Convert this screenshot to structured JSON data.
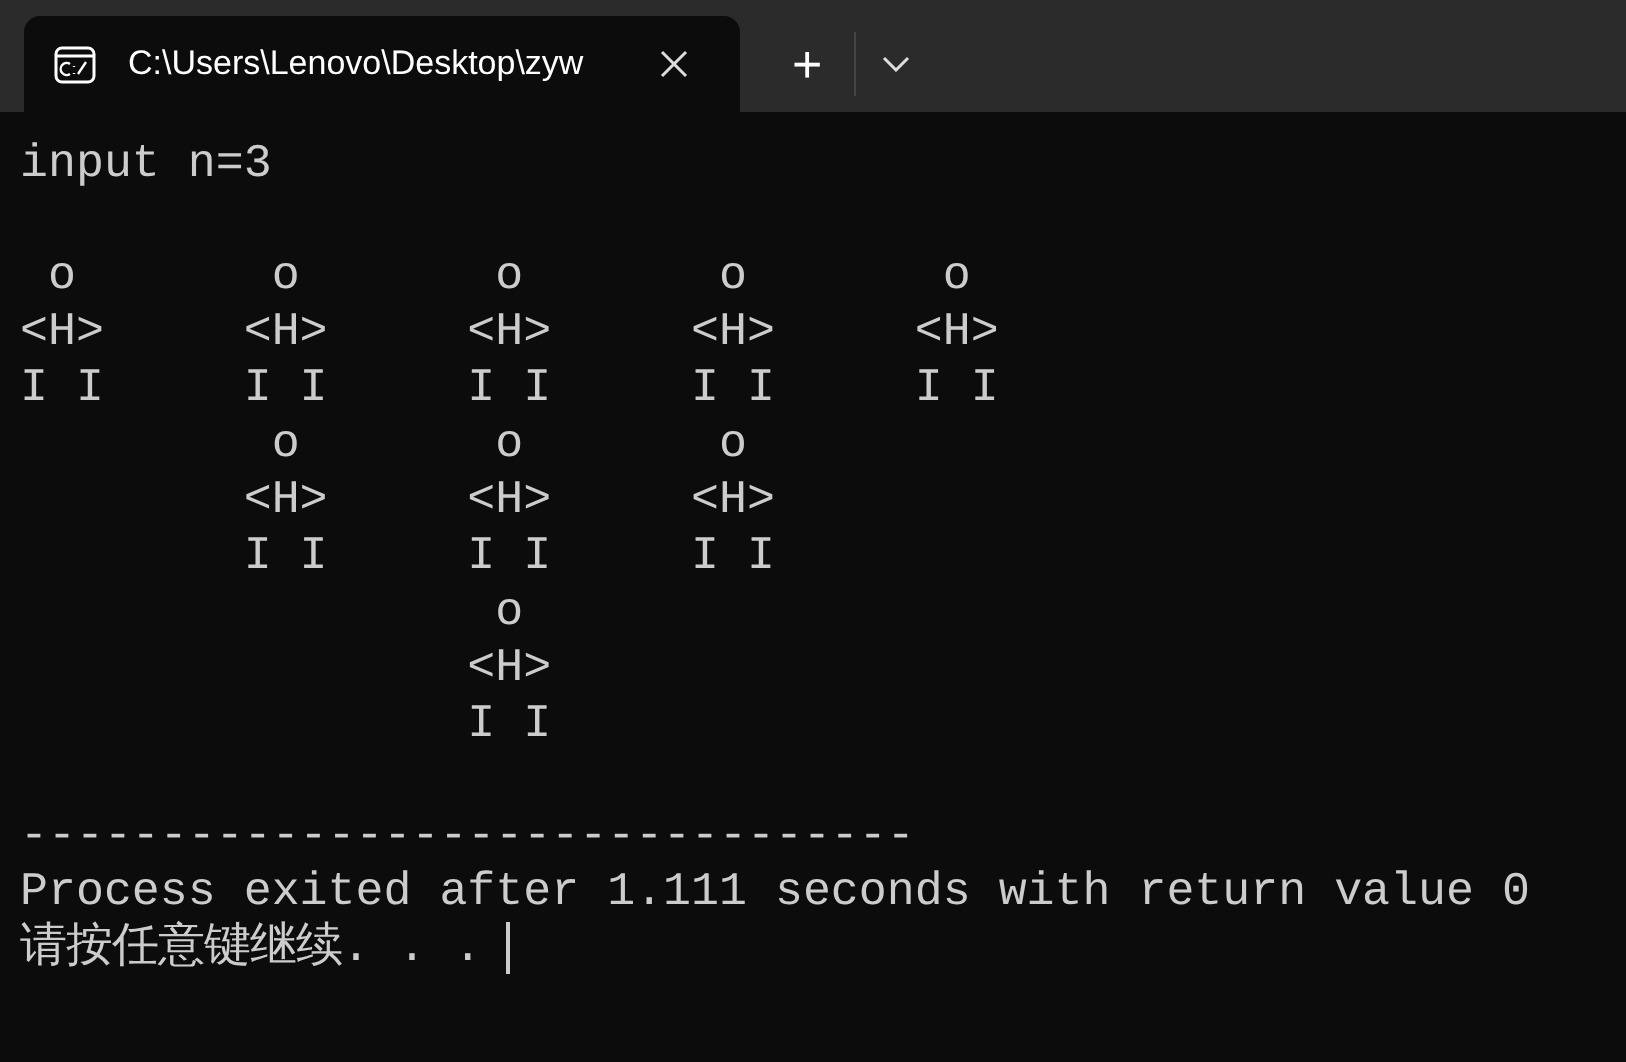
{
  "tabs": [
    {
      "title": "C:\\Users\\Lenovo\\Desktop\\zyw",
      "selected": true
    }
  ],
  "new_tab_button": "+",
  "console": {
    "lines": [
      {
        "kind": "text",
        "text": "input n=3"
      },
      {
        "kind": "blank"
      },
      {
        "kind": "text",
        "text": " o       o       o       o       o"
      },
      {
        "kind": "text",
        "text": "<H>     <H>     <H>     <H>     <H>"
      },
      {
        "kind": "text",
        "text": "I I     I I     I I     I I     I I"
      },
      {
        "kind": "text",
        "text": "         o       o       o"
      },
      {
        "kind": "text",
        "text": "        <H>     <H>     <H>"
      },
      {
        "kind": "text",
        "text": "        I I     I I     I I"
      },
      {
        "kind": "text",
        "text": "                 o"
      },
      {
        "kind": "text",
        "text": "                <H>"
      },
      {
        "kind": "text",
        "text": "                I I"
      },
      {
        "kind": "blank"
      },
      {
        "kind": "text",
        "text": "--------------------------------"
      },
      {
        "kind": "text",
        "text": "Process exited after 1.111 seconds with return value 0"
      },
      {
        "kind": "prompt",
        "text": "请按任意键继续. . ."
      }
    ]
  }
}
